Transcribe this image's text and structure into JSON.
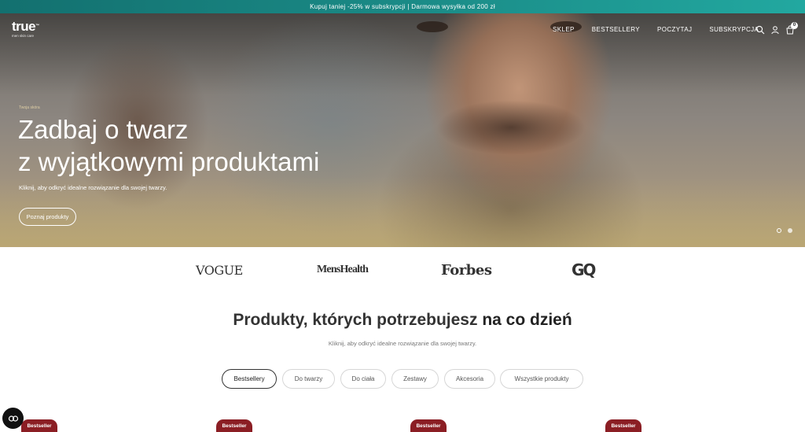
{
  "promo": {
    "text": "Kupuj taniej -25% w subskrypcji | Darmowa wysyłka od 200 zł"
  },
  "logo": {
    "word": "true",
    "sup": "™",
    "tagline": "men skin care"
  },
  "nav": {
    "items": [
      {
        "label": "SKLEP"
      },
      {
        "label": "BESTSELLERY"
      },
      {
        "label": "POCZYTAJ"
      },
      {
        "label": "SUBSKRYPCJA"
      }
    ],
    "icons": [
      "search-icon",
      "account-icon",
      "cart-icon"
    ],
    "cart_count": "0"
  },
  "hero": {
    "eyebrow": "Twoja skóra",
    "title_line1": "Zadbaj o twarz",
    "title_line2": "z wyjątkowymi produktami",
    "subtitle": "Kliknij, aby odkryć idealne rozwiązanie dla swojej twarzy.",
    "cta": "Poznaj produkty",
    "slide_count": 2,
    "active_slide": 1
  },
  "press": {
    "logos": [
      "VOGUE",
      "MensHealth",
      "Forbes",
      "GQ"
    ]
  },
  "products_section": {
    "title_regular": "Produkty, których potrzebujesz ",
    "title_bold": "na co dzień",
    "subtitle": "Kliknij, aby odkryć idealne rozwiązanie dla swojej twarzy.",
    "filters": [
      {
        "label": "Bestsellery",
        "active": true
      },
      {
        "label": "Do twarzy",
        "active": false
      },
      {
        "label": "Do ciała",
        "active": false
      },
      {
        "label": "Zestawy",
        "active": false
      },
      {
        "label": "Akcesoria",
        "active": false
      },
      {
        "label": "Wszystkie produkty",
        "active": false
      }
    ],
    "badges": [
      "Bestseller",
      "Bestseller",
      "Bestseller",
      "Bestseller"
    ]
  },
  "colors": {
    "promo_bar": "#1a8a86",
    "badge": "#8b1e24",
    "text_dark": "#222222",
    "chat_button": "#111111"
  }
}
